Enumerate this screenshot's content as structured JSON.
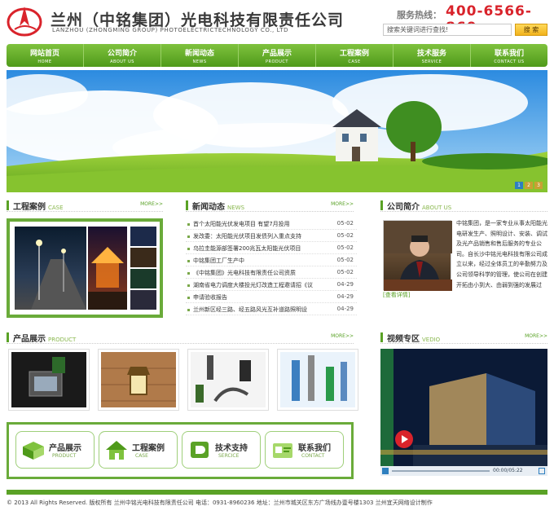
{
  "header": {
    "company_name": "兰州（中铭集团）光电科技有限责任公司",
    "company_en": "LANZHOU (ZHONGMING GROUP) PHOTOELECTRICTECHNOLOGY CO., LTD",
    "hotline_label": "服务热线：",
    "hotline_number": "400-6566-860",
    "search_placeholder": "搜索关键词进行查找!",
    "search_button": "搜 索"
  },
  "nav": [
    {
      "cn": "网站首页",
      "en": "HOME"
    },
    {
      "cn": "公司简介",
      "en": "ABOUT US"
    },
    {
      "cn": "新闻动态",
      "en": "NEWS"
    },
    {
      "cn": "产品展示",
      "en": "PRODUCT"
    },
    {
      "cn": "工程案例",
      "en": "CASE"
    },
    {
      "cn": "技术服务",
      "en": "SERVICE"
    },
    {
      "cn": "联系我们",
      "en": "CONTACT US"
    }
  ],
  "banner": {
    "dots": [
      "1",
      "2",
      "3"
    ]
  },
  "cases": {
    "title": "工程案例",
    "en": "CASE",
    "more": "MORE>>"
  },
  "news": {
    "title": "新闻动态",
    "en": "NEWS",
    "more": "MORE>>",
    "items": [
      {
        "text": "首个太阳能光伏发电项目 有望7月投用",
        "date": "05-02"
      },
      {
        "text": "发改委：太阳能光伏项目发债列入重点支持",
        "date": "05-02"
      },
      {
        "text": "乌拉圭能源部签署200兆瓦太阳能光伏项目",
        "date": "05-02"
      },
      {
        "text": "中铭集团工厂生产中",
        "date": "05-02"
      },
      {
        "text": "《中铭集团》光电科技有限责任公司资质",
        "date": "05-02"
      },
      {
        "text": "湖南省电力调度大楼投光灯改造工程邀请招《议",
        "date": "04-29"
      },
      {
        "text": "申请验收报告",
        "date": "04-29"
      },
      {
        "text": "兰州新区经三路、经五路风光互补道路照明设",
        "date": "04-29"
      }
    ]
  },
  "about": {
    "title": "公司简介",
    "en": "ABOUT US",
    "text": "中铭集团，是一家专业从事太阳能光电研发生产、照明设计、安装、调试及光产品销售和售后服务的专业公司。自长沙中铭光电科技有限公司成立以来，经过全体员工的辛勤努力及公司领导科学的管理，使公司在创建开拓由小到大、由弱到强的发展过程，并逐步形成了以技术优势突出，服务体系完善...",
    "more": "[查看详情]"
  },
  "products": {
    "title": "产品展示",
    "en": "PRODUCT",
    "more": "MORE>>"
  },
  "quick_buttons": [
    {
      "cn": "产品展示",
      "en": "PRODUCT"
    },
    {
      "cn": "工程案例",
      "en": "CASE"
    },
    {
      "cn": "技术支持",
      "en": "SERCICE"
    },
    {
      "cn": "联系我们",
      "en": "CONTACT"
    }
  ],
  "video": {
    "title": "视频专区",
    "en": "VEDIO",
    "more": "MORE>>",
    "time": "00:00/05:22"
  },
  "footer": {
    "text": "© 2013 All Rights Reserved. 版权所有 兰州中铭光电科技有限责任公司    电话：0931-8960236    地址：兰州市城关区东方广场线办壹号楼1303    兰州宜天网络设计制作"
  }
}
